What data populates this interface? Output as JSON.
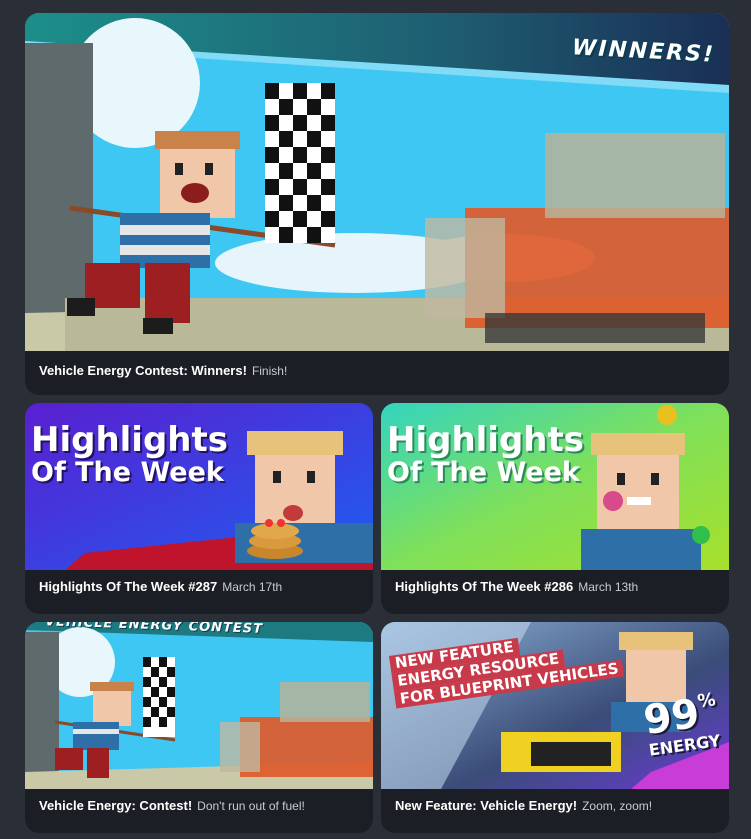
{
  "featured": {
    "banner_text": "WINNERS!",
    "title": "Vehicle Energy Contest: Winners!",
    "subtitle": "Finish!",
    "image_icon": "checkered-flag-icon"
  },
  "cards": [
    {
      "image_line1": "Highlights",
      "image_line2": "Of The Week",
      "title": "Highlights Of The Week #287",
      "subtitle": "March 17th"
    },
    {
      "image_line1": "Highlights",
      "image_line2": "Of The Week",
      "title": "Highlights Of The Week #286",
      "subtitle": "March 13th"
    },
    {
      "banner_text": "VEHICLE ENERGY CONTEST",
      "title": "Vehicle Energy: Contest!",
      "subtitle": "Don't run out of fuel!"
    },
    {
      "image_line1": "NEW FEATURE",
      "image_line2": "ENERGY RESOURCE",
      "image_line3": "FOR BLUEPRINT VEHICLES",
      "percent_number": "99",
      "percent_sign": "%",
      "percent_label": "ENERGY",
      "title": "New Feature: Vehicle Energy!",
      "subtitle": "Zoom, zoom!"
    }
  ],
  "colors": {
    "page_bg": "#2a2e36",
    "card_bg": "#1b1e24",
    "sky": "#3ec7f2",
    "purple_bg": "#3a2bd0",
    "green_bg": "#7fd84a",
    "energy_red": "#c8394a"
  }
}
